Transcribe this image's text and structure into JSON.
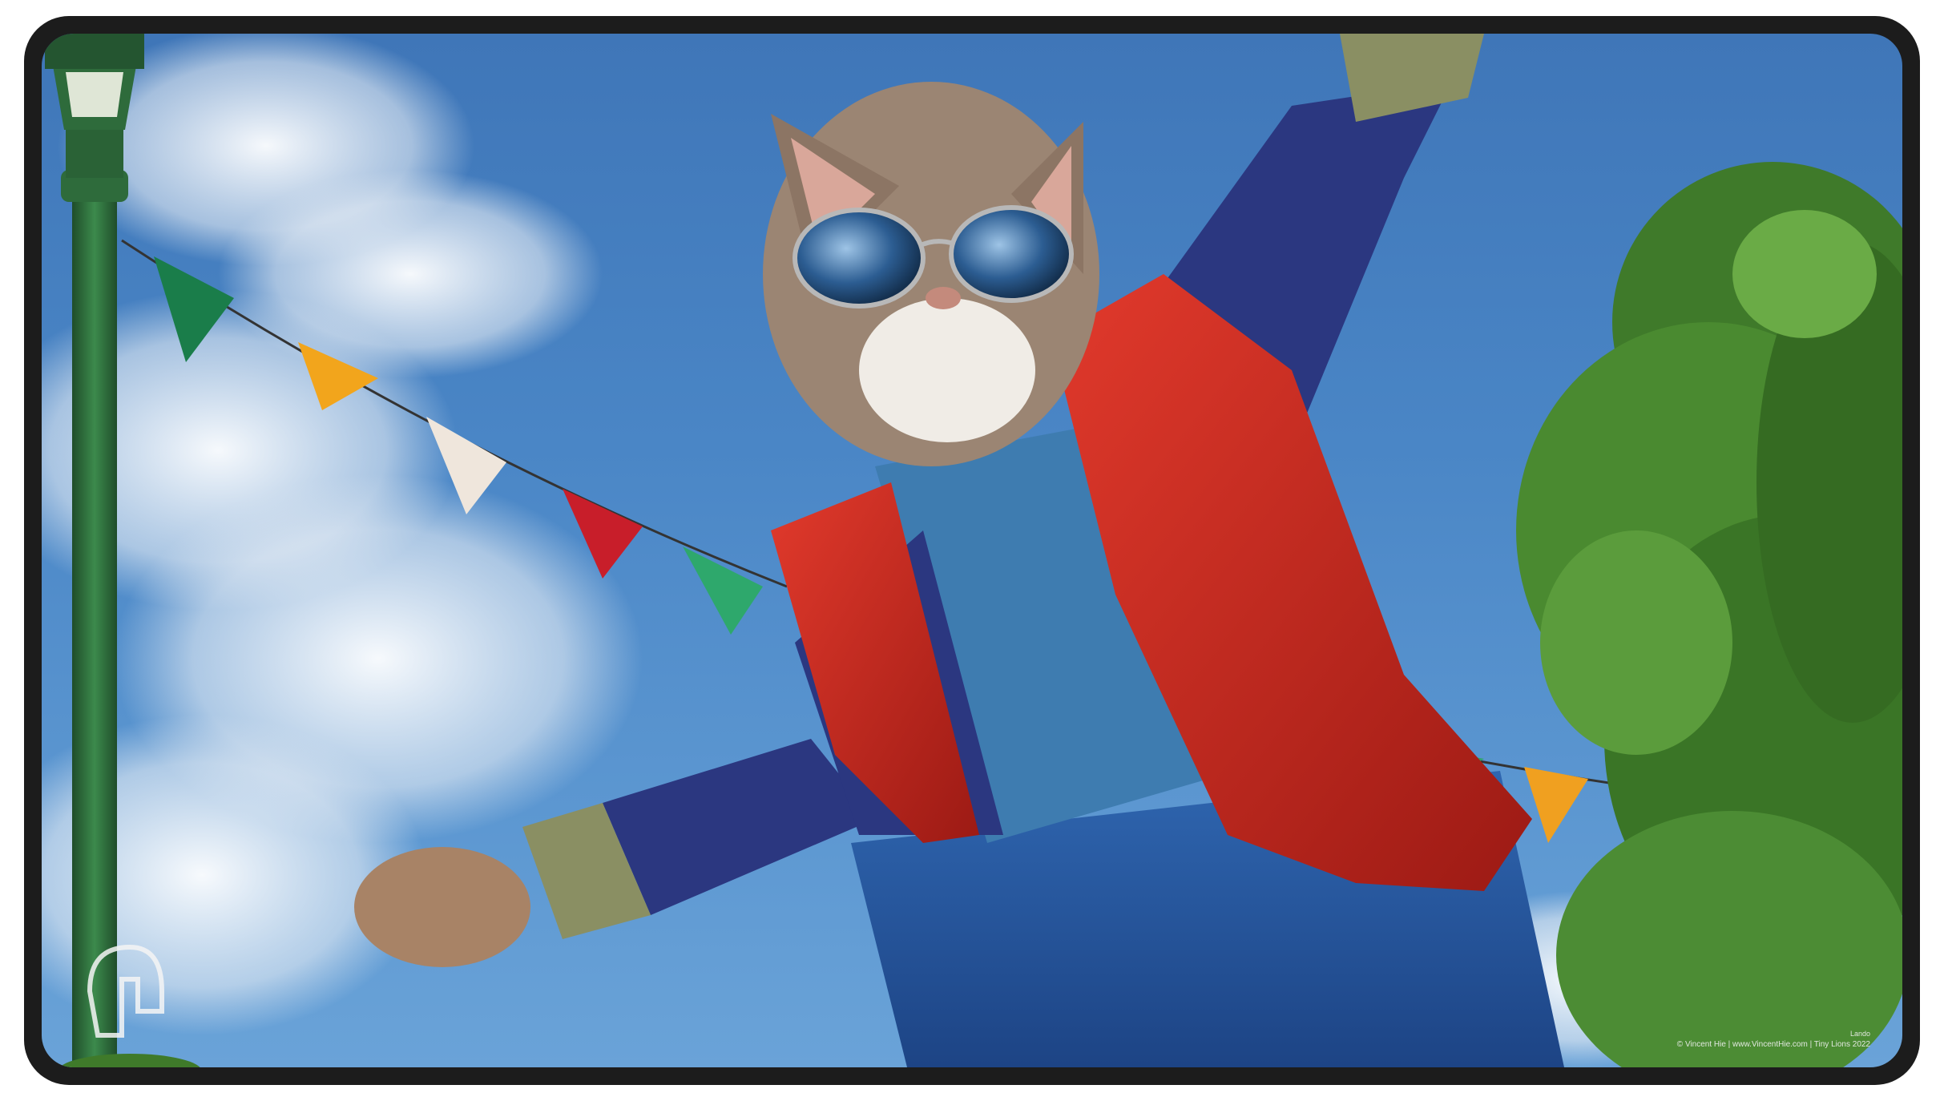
{
  "artwork": {
    "subject": "cat",
    "publisher_logo_icon": "spartan-helmet-icon"
  },
  "credit": {
    "label": "Lando",
    "line": "© Vincent Hie | www.VincentHie.com | Tiny Lions 2022"
  },
  "colors": {
    "border": "#1c1c1c",
    "sky": "#4a86c6",
    "vest": "#c5251c",
    "sleeve": "#2b3780",
    "shirt": "#3e7cb0",
    "jeans": "#25549a",
    "foliage": "#3f7a2a",
    "lamp_post": "#2e6b3b"
  },
  "bunting_colors": [
    "#1a7d4a",
    "#f2a51c",
    "#efe6dc",
    "#c81e2a",
    "#2ea86c",
    "#2fa36a",
    "#f0a020",
    "#f3e9e4",
    "#d8283c",
    "#5cc09a",
    "#f3a223"
  ]
}
